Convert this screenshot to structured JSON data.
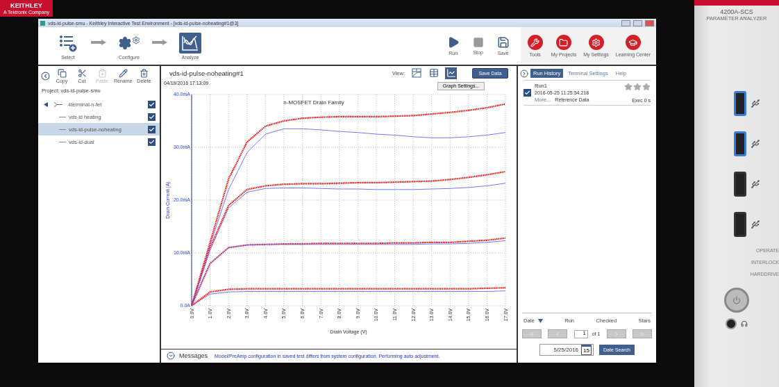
{
  "brand": {
    "logo": "KEITHLEY",
    "tagline": "A Tektronix Company"
  },
  "window": {
    "title": "vds-id-pulse-smu - Keithley Interactive Test Environment - [vds-id-pulse-noheating#1@3]"
  },
  "workflow": [
    {
      "kind": "select",
      "label": "Select",
      "selected": false
    },
    {
      "kind": "configure",
      "label": "Configure",
      "selected": false
    },
    {
      "kind": "analyze",
      "label": "Analyze",
      "selected": true
    }
  ],
  "run_controls": [
    {
      "kind": "run",
      "label": "Run"
    },
    {
      "kind": "stop",
      "label": "Stop"
    },
    {
      "kind": "save",
      "label": "Save"
    }
  ],
  "tools": [
    {
      "kind": "tools",
      "label": "Tools"
    },
    {
      "kind": "projects",
      "label": "My Projects"
    },
    {
      "kind": "settings",
      "label": "My Settings"
    },
    {
      "kind": "learning",
      "label": "Learning Center"
    }
  ],
  "project_panel": {
    "actions": [
      {
        "kind": "copy",
        "label": "Copy",
        "disabled": false
      },
      {
        "kind": "cut",
        "label": "Cut",
        "disabled": false
      },
      {
        "kind": "paste",
        "label": "Paste",
        "disabled": true
      },
      {
        "kind": "rename",
        "label": "Rename",
        "disabled": false
      },
      {
        "kind": "delete",
        "label": "Delete",
        "disabled": false
      }
    ],
    "project": "Project: vds-id-pulse-smu",
    "tree": [
      {
        "label": "4terminal-n-fet",
        "expanded": true,
        "checked": true,
        "selected": false,
        "children": [
          {
            "label": "vds-id heating",
            "checked": true,
            "selected": false
          },
          {
            "label": "vds-id-pulse-noheating",
            "checked": true,
            "selected": true
          },
          {
            "label": "vds-id-dual",
            "checked": true,
            "selected": false
          }
        ]
      }
    ]
  },
  "analysis": {
    "title": "vds-id-pulse-noheating#1",
    "view_label": "View:",
    "views": [
      {
        "kind": "sheet",
        "selected": false
      },
      {
        "kind": "table",
        "selected": false
      },
      {
        "kind": "graph",
        "selected": true
      }
    ],
    "save_button": "Save Data",
    "timestamp": "04/19/2016 17:13:09",
    "graph_settings": "Graph Settings...",
    "chart_data": {
      "type": "line",
      "grid": true,
      "title": "n-MOSFET Drain Family",
      "xlabel": "Drain Voltage (V)",
      "ylabel": "Drain Current (A)",
      "x": [
        0,
        1,
        2,
        3,
        4,
        5,
        6,
        7,
        8,
        9,
        10,
        11,
        12,
        13,
        14,
        15,
        16,
        17
      ],
      "xticks": [
        {
          "value": 0,
          "label": "0.0V"
        },
        {
          "value": 1,
          "label": "1.0V"
        },
        {
          "value": 2,
          "label": "2.0V"
        },
        {
          "value": 3,
          "label": "3.0V"
        },
        {
          "value": 4,
          "label": "4.0V"
        },
        {
          "value": 5,
          "label": "5.0V"
        },
        {
          "value": 6,
          "label": "6.0V"
        },
        {
          "value": 7,
          "label": "7.0V"
        },
        {
          "value": 8,
          "label": "8.0V"
        },
        {
          "value": 9,
          "label": "9.0V"
        },
        {
          "value": 10,
          "label": "10.0V"
        },
        {
          "value": 11,
          "label": "11.0V"
        },
        {
          "value": 12,
          "label": "12.0V"
        },
        {
          "value": 13,
          "label": "13.0V"
        },
        {
          "value": 14,
          "label": "14.0V"
        },
        {
          "value": 15,
          "label": "15.0V"
        },
        {
          "value": 16,
          "label": "16.0V"
        },
        {
          "value": 17,
          "label": "17.0V"
        }
      ],
      "yticks": [
        {
          "value": 0,
          "label": "0.0A"
        },
        {
          "value": 10,
          "label": "10.0mA"
        },
        {
          "value": 20,
          "label": "20.0mA"
        },
        {
          "value": 30,
          "label": "30.0mA"
        },
        {
          "value": 40,
          "label": "40.0mA"
        }
      ],
      "xlim": [
        0,
        17
      ],
      "ylim": [
        0,
        40
      ],
      "series": [
        {
          "color": "#ff0000",
          "line_style": "dotted",
          "values": [
            0,
            12,
            24,
            31,
            34,
            35,
            35.5,
            35.7,
            35.8,
            35.8,
            35.8,
            35.9,
            36,
            36.3,
            36.6,
            37,
            37.5,
            38.2
          ]
        },
        {
          "color": "#6666ff",
          "line_style": "solid",
          "values": [
            0,
            11.5,
            22,
            29,
            32.5,
            33.5,
            33.5,
            33.3,
            33,
            32.8,
            32.5,
            32.3,
            32,
            31.8,
            31.8,
            32,
            32.3,
            32.8
          ]
        },
        {
          "color": "#ff0000",
          "line_style": "dotted",
          "values": [
            0,
            11,
            19,
            22,
            22.7,
            23,
            23.1,
            23.1,
            23.2,
            23.3,
            23.3,
            23.4,
            23.5,
            23.6,
            23.9,
            24.3,
            24.8,
            25.4
          ]
        },
        {
          "color": "#6666ff",
          "line_style": "solid",
          "values": [
            0,
            10.5,
            18.5,
            21.5,
            22.2,
            22.3,
            22.3,
            22.2,
            22.1,
            22.1,
            22,
            22,
            22,
            22.1,
            22.2,
            22.4,
            22.7,
            23.2
          ]
        },
        {
          "color": "#ff0000",
          "line_style": "dotted",
          "values": [
            0,
            8,
            11,
            11.5,
            11.6,
            11.7,
            11.7,
            11.8,
            11.8,
            11.8,
            11.8,
            11.9,
            11.9,
            12,
            12,
            12.2,
            12.4,
            12.8
          ]
        },
        {
          "color": "#6666ff",
          "line_style": "solid",
          "values": [
            0,
            8,
            11,
            11.5,
            11.6,
            11.6,
            11.6,
            11.6,
            11.6,
            11.6,
            11.6,
            11.6,
            11.6,
            11.7,
            11.7,
            11.8,
            12,
            12.3
          ]
        },
        {
          "color": "#ff0000",
          "line_style": "dotted",
          "values": [
            0,
            2.6,
            3.1,
            3.2,
            3.2,
            3.2,
            3.2,
            3.2,
            3.2,
            3.2,
            3.2,
            3.2,
            3.2,
            3.2,
            3.2,
            3.2,
            3.3,
            3.4
          ]
        },
        {
          "color": "#6666ff",
          "line_style": "solid",
          "values": [
            0,
            2.2,
            2.6,
            2.7,
            2.7,
            2.7,
            2.7,
            2.7,
            2.7,
            2.7,
            2.7,
            2.7,
            2.7,
            2.7,
            2.7,
            2.7,
            2.7,
            2.8
          ]
        }
      ]
    }
  },
  "messages": {
    "label": "Messages",
    "text": "Model/PreAmp configuration in saved test differs from system configuration. Performing auto adjustment."
  },
  "run_panel": {
    "tabs": [
      {
        "label": "Run History",
        "selected": true
      },
      {
        "label": "Terminal Settings",
        "selected": false
      },
      {
        "label": "Help",
        "selected": false
      }
    ],
    "runs": [
      {
        "name": "Run1",
        "timestamp": "2016-05-25 11:25:54.218",
        "more": "More...",
        "note": "Reference Data",
        "exec": "Exec 0 s",
        "checked": true,
        "stars": 0
      }
    ],
    "columns": [
      "Date",
      "Run",
      "Checked",
      "Stars"
    ],
    "page": "1",
    "page_of": "of 1",
    "date": "5/25/2016",
    "calendar_day": "15",
    "date_search": "Date Search"
  },
  "device": {
    "model": "4200A-SCS",
    "name": "PARAMETER ANALYZER",
    "indicators": [
      "OPERATE",
      "INTERLOCK",
      "HARDDRIVE"
    ]
  }
}
